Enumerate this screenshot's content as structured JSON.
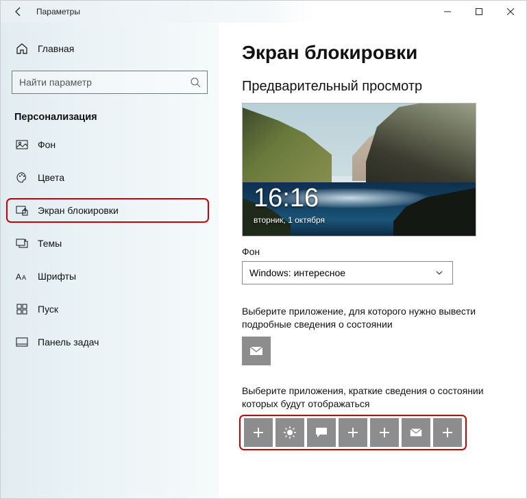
{
  "window": {
    "title": "Параметры"
  },
  "sidebar": {
    "home": "Главная",
    "search_placeholder": "Найти параметр",
    "section": "Персонализация",
    "items": [
      {
        "label": "Фон"
      },
      {
        "label": "Цвета"
      },
      {
        "label": "Экран блокировки"
      },
      {
        "label": "Темы"
      },
      {
        "label": "Шрифты"
      },
      {
        "label": "Пуск"
      },
      {
        "label": "Панель задач"
      }
    ]
  },
  "main": {
    "heading": "Экран блокировки",
    "preview_label": "Предварительный просмотр",
    "clock": "16:16",
    "date": "вторник, 1 октября",
    "background_label": "Фон",
    "background_value": "Windows: интересное",
    "detailed_label": "Выберите приложение, для которого нужно вывести подробные сведения о состоянии",
    "quick_label": "Выберите приложения, краткие сведения о состоянии которых будут отображаться"
  }
}
